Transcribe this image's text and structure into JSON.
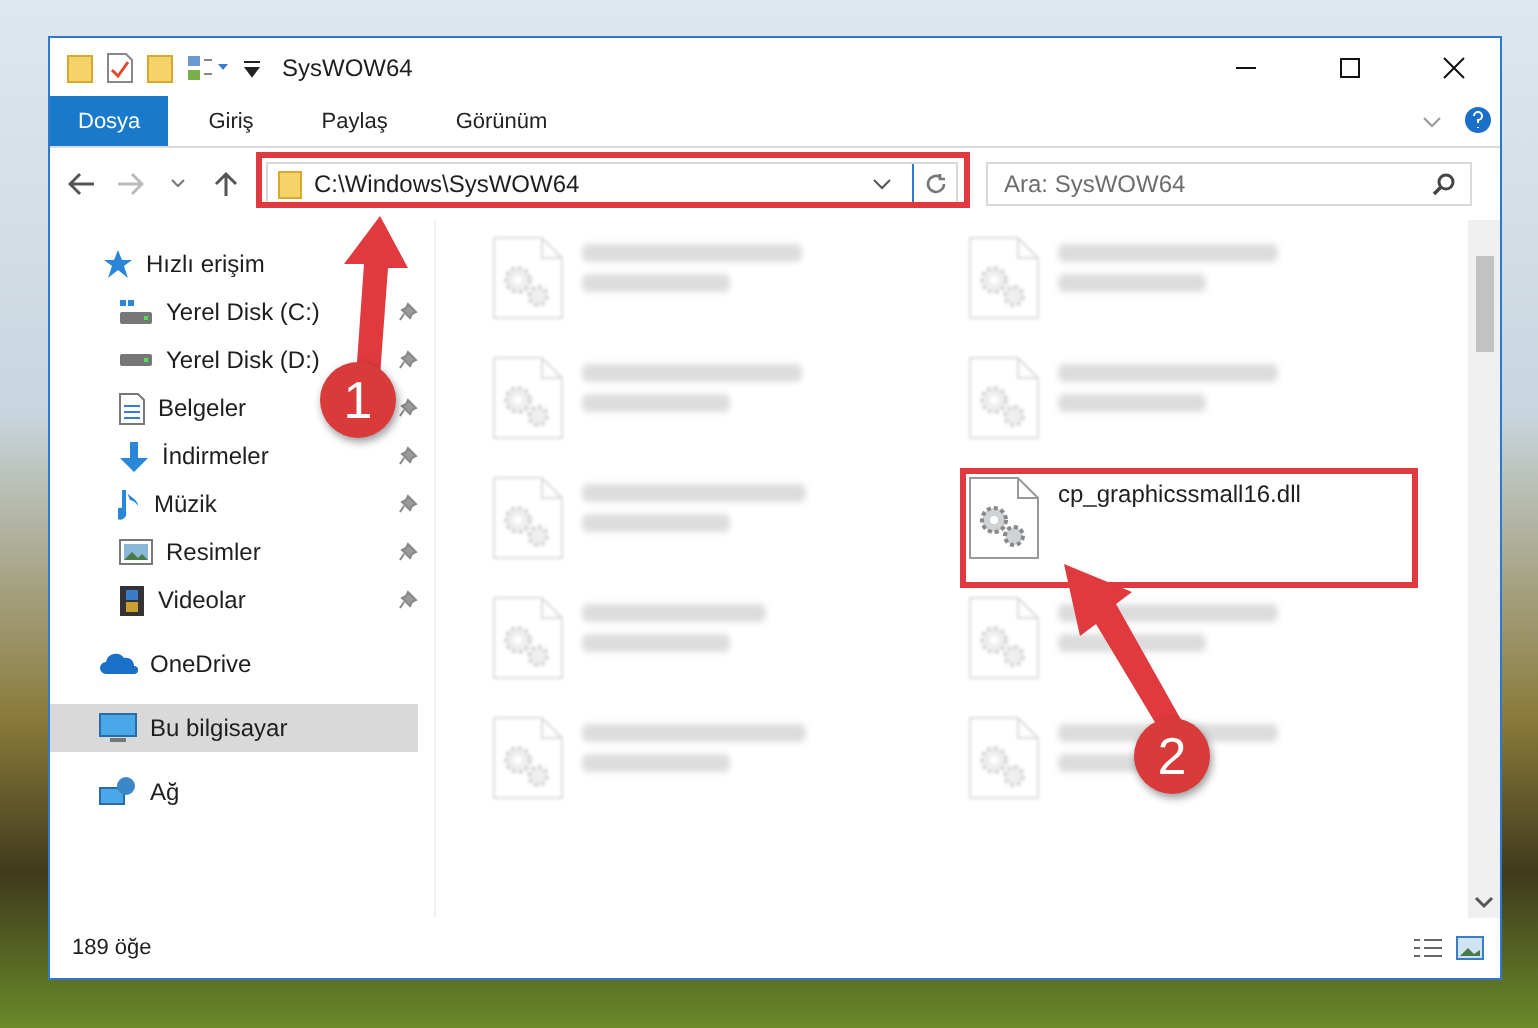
{
  "window": {
    "title": "SysWOW64"
  },
  "ribbon_tabs": [
    {
      "label": "Dosya",
      "selected": true
    },
    {
      "label": "Giriş",
      "selected": false
    },
    {
      "label": "Paylaş",
      "selected": false
    },
    {
      "label": "Görünüm",
      "selected": false
    }
  ],
  "address": {
    "value": "C:\\Windows\\SysWOW64"
  },
  "search": {
    "placeholder": "Ara: SysWOW64"
  },
  "sidebar": {
    "items": [
      {
        "label": "Hızlı erişim",
        "kind": "star",
        "selected": false,
        "children": [
          {
            "label": "Yerel Disk (C:)",
            "kind": "windrive",
            "pinned": true
          },
          {
            "label": "Yerel Disk (D:)",
            "kind": "drive",
            "pinned": true
          },
          {
            "label": "Belgeler",
            "kind": "documents",
            "pinned": true
          },
          {
            "label": "İndirmeler",
            "kind": "downloads",
            "pinned": true
          },
          {
            "label": "Müzik",
            "kind": "music",
            "pinned": true
          },
          {
            "label": "Resimler",
            "kind": "pictures",
            "pinned": true
          },
          {
            "label": "Videolar",
            "kind": "videos",
            "pinned": true
          }
        ]
      },
      {
        "label": "OneDrive",
        "kind": "cloud",
        "selected": false
      },
      {
        "label": "Bu bilgisayar",
        "kind": "computer",
        "selected": true
      },
      {
        "label": "Ağ",
        "kind": "network",
        "selected": false
      }
    ]
  },
  "files": [
    {
      "kind": "blurred"
    },
    {
      "kind": "blurred"
    },
    {
      "kind": "blurred"
    },
    {
      "kind": "blurred"
    },
    {
      "kind": "blurred"
    },
    {
      "name": "cp_graphicssmall16.dll",
      "kind": "normal"
    },
    {
      "kind": "blurred"
    },
    {
      "kind": "blurred"
    },
    {
      "kind": "blurred"
    },
    {
      "kind": "blurred"
    }
  ],
  "status_bar": {
    "count": "189 öğe"
  },
  "annotations": [
    {
      "label": "1"
    },
    {
      "label": "2"
    }
  ]
}
